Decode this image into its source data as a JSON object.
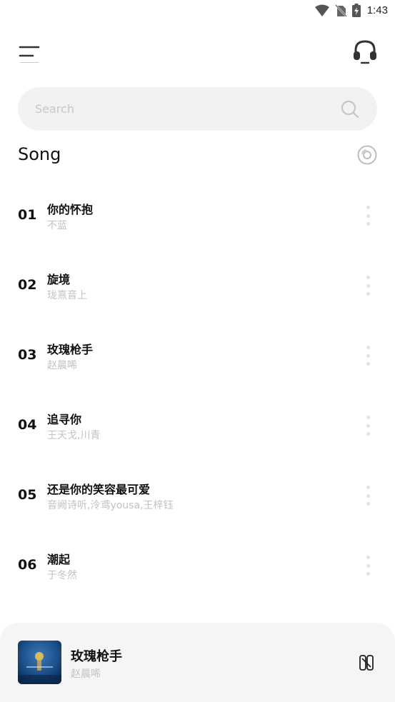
{
  "status_bar": {
    "time": "1:43",
    "icons": [
      "wifi-icon",
      "no-sim-icon",
      "battery-charging-icon"
    ]
  },
  "top_bar": {
    "menu_icon": "hamburger-menu-icon",
    "right_icon": "headset-icon"
  },
  "search": {
    "placeholder": "Search",
    "value": "",
    "icon": "search-icon"
  },
  "section": {
    "title": "Song",
    "icon": "disc-icon"
  },
  "songs": [
    {
      "number": "01",
      "title": "你的怀抱",
      "artist": "不蓝"
    },
    {
      "number": "02",
      "title": "旋境",
      "artist": "珑熹音上"
    },
    {
      "number": "03",
      "title": "玫瑰枪手",
      "artist": "赵晨唏"
    },
    {
      "number": "04",
      "title": "追寻你",
      "artist": "王天戈,川青"
    },
    {
      "number": "05",
      "title": "还是你的笑容最可爱",
      "artist": "音阙诗听,泠鸢yousa,王梓钰"
    },
    {
      "number": "06",
      "title": "潮起",
      "artist": "于冬然"
    }
  ],
  "mini_player": {
    "title": "玫瑰枪手",
    "artist": "赵晨唏",
    "control_icon": "play-pause-icon"
  },
  "colors": {
    "background": "#ffffff",
    "search_bg": "#f2f2f2",
    "subtext": "#c2c2c2",
    "player_bg": "#f5f5f5",
    "album_blue": "#1c4f8a"
  }
}
